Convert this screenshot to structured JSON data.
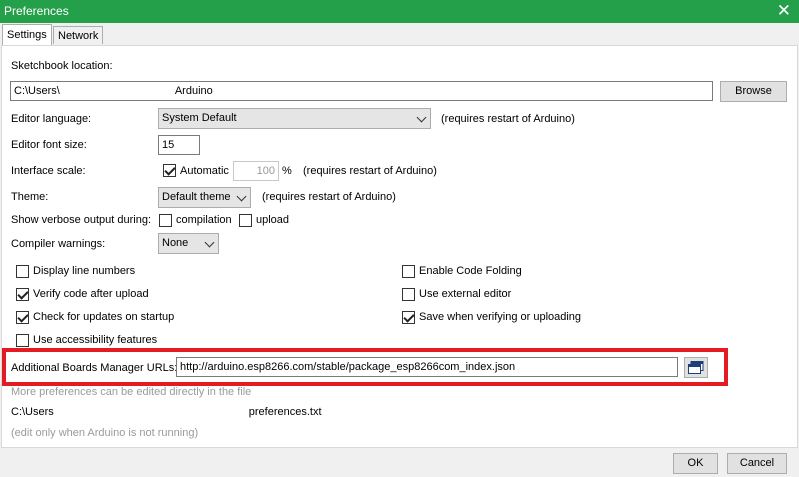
{
  "window": {
    "title": "Preferences"
  },
  "tabs": [
    {
      "label": "Settings"
    },
    {
      "label": "Network"
    }
  ],
  "sketchbook": {
    "label": "Sketchbook location:",
    "path_start": "C:\\Users\\",
    "path_end": "Arduino",
    "browse": "Browse"
  },
  "editor_language": {
    "label": "Editor language:",
    "value": "System Default",
    "note": "(requires restart of Arduino)"
  },
  "font_size": {
    "label": "Editor font size:",
    "value": "15"
  },
  "interface_scale": {
    "label": "Interface scale:",
    "auto_label": "Automatic",
    "auto_checked": true,
    "value": "100",
    "unit": "%",
    "note": "(requires restart of Arduino)"
  },
  "theme": {
    "label": "Theme:",
    "value": "Default theme",
    "note": "(requires restart of Arduino)"
  },
  "verbose": {
    "label": "Show verbose output during:",
    "compilation": "compilation",
    "compilation_checked": false,
    "upload": "upload",
    "upload_checked": false
  },
  "warnings": {
    "label": "Compiler warnings:",
    "value": "None"
  },
  "options_left": [
    {
      "label": "Display line numbers",
      "checked": false
    },
    {
      "label": "Verify code after upload",
      "checked": true
    },
    {
      "label": "Check for updates on startup",
      "checked": true
    },
    {
      "label": "Use accessibility features",
      "checked": false
    }
  ],
  "options_right": [
    {
      "label": "Enable Code Folding",
      "checked": false
    },
    {
      "label": "Use external editor",
      "checked": false
    },
    {
      "label": "Save when verifying or uploading",
      "checked": true
    }
  ],
  "boards": {
    "label": "Additional Boards Manager URLs:",
    "value": "http://arduino.esp8266.com/stable/package_esp8266com_index.json"
  },
  "footer": {
    "more": "More preferences can be edited directly in the file",
    "path_start": "C:\\Users",
    "path_end": "preferences.txt",
    "note": "(edit only when Arduino is not running)"
  },
  "buttons": {
    "ok": "OK",
    "cancel": "Cancel"
  },
  "colors": {
    "titlebar": "#24a04a",
    "highlight": "#e31b23"
  }
}
